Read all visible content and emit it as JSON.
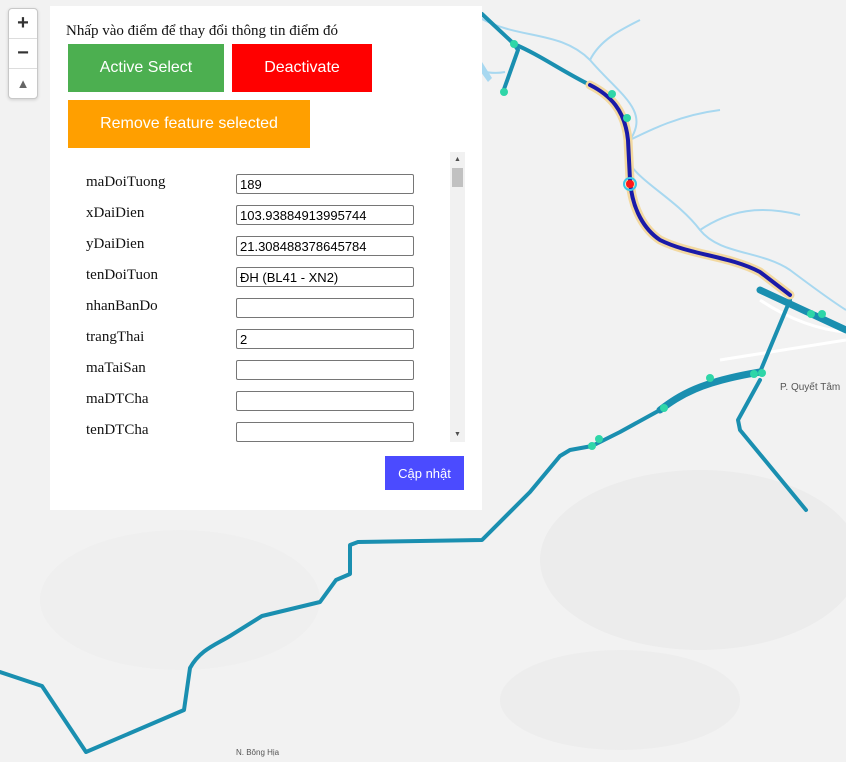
{
  "map": {
    "place_labels": [
      "P. Quyết Tâm",
      "N. Bông Hịa"
    ],
    "colors": {
      "background": "#f2f2f2",
      "road": "#1a8fb0",
      "selected_route": "#1a1aa8",
      "node": "#2fd6a8",
      "selected_node": "#ff1a1a",
      "river": "#a8d8f0"
    }
  },
  "zoom_control": {
    "zoom_in": "+",
    "zoom_out": "−",
    "reset_north": "▲"
  },
  "panel": {
    "instruction": "Nhấp vào điểm để thay đổi thông tin điểm đó",
    "buttons": {
      "active_select": "Active Select",
      "deactivate": "Deactivate",
      "remove_feature": "Remove feature selected",
      "update": "Cập nhật"
    },
    "fields": [
      {
        "label": "maDoiTuong",
        "value": "189"
      },
      {
        "label": "xDaiDien",
        "value": "103.93884913995744"
      },
      {
        "label": "yDaiDien",
        "value": "21.308488378645784"
      },
      {
        "label": "tenDoiTuon",
        "value": "ĐH (BL41 - XN2)"
      },
      {
        "label": "nhanBanDo",
        "value": ""
      },
      {
        "label": "trangThai",
        "value": "2"
      },
      {
        "label": "maTaiSan",
        "value": ""
      },
      {
        "label": "maDTCha",
        "value": ""
      },
      {
        "label": "tenDTCha",
        "value": ""
      }
    ]
  }
}
